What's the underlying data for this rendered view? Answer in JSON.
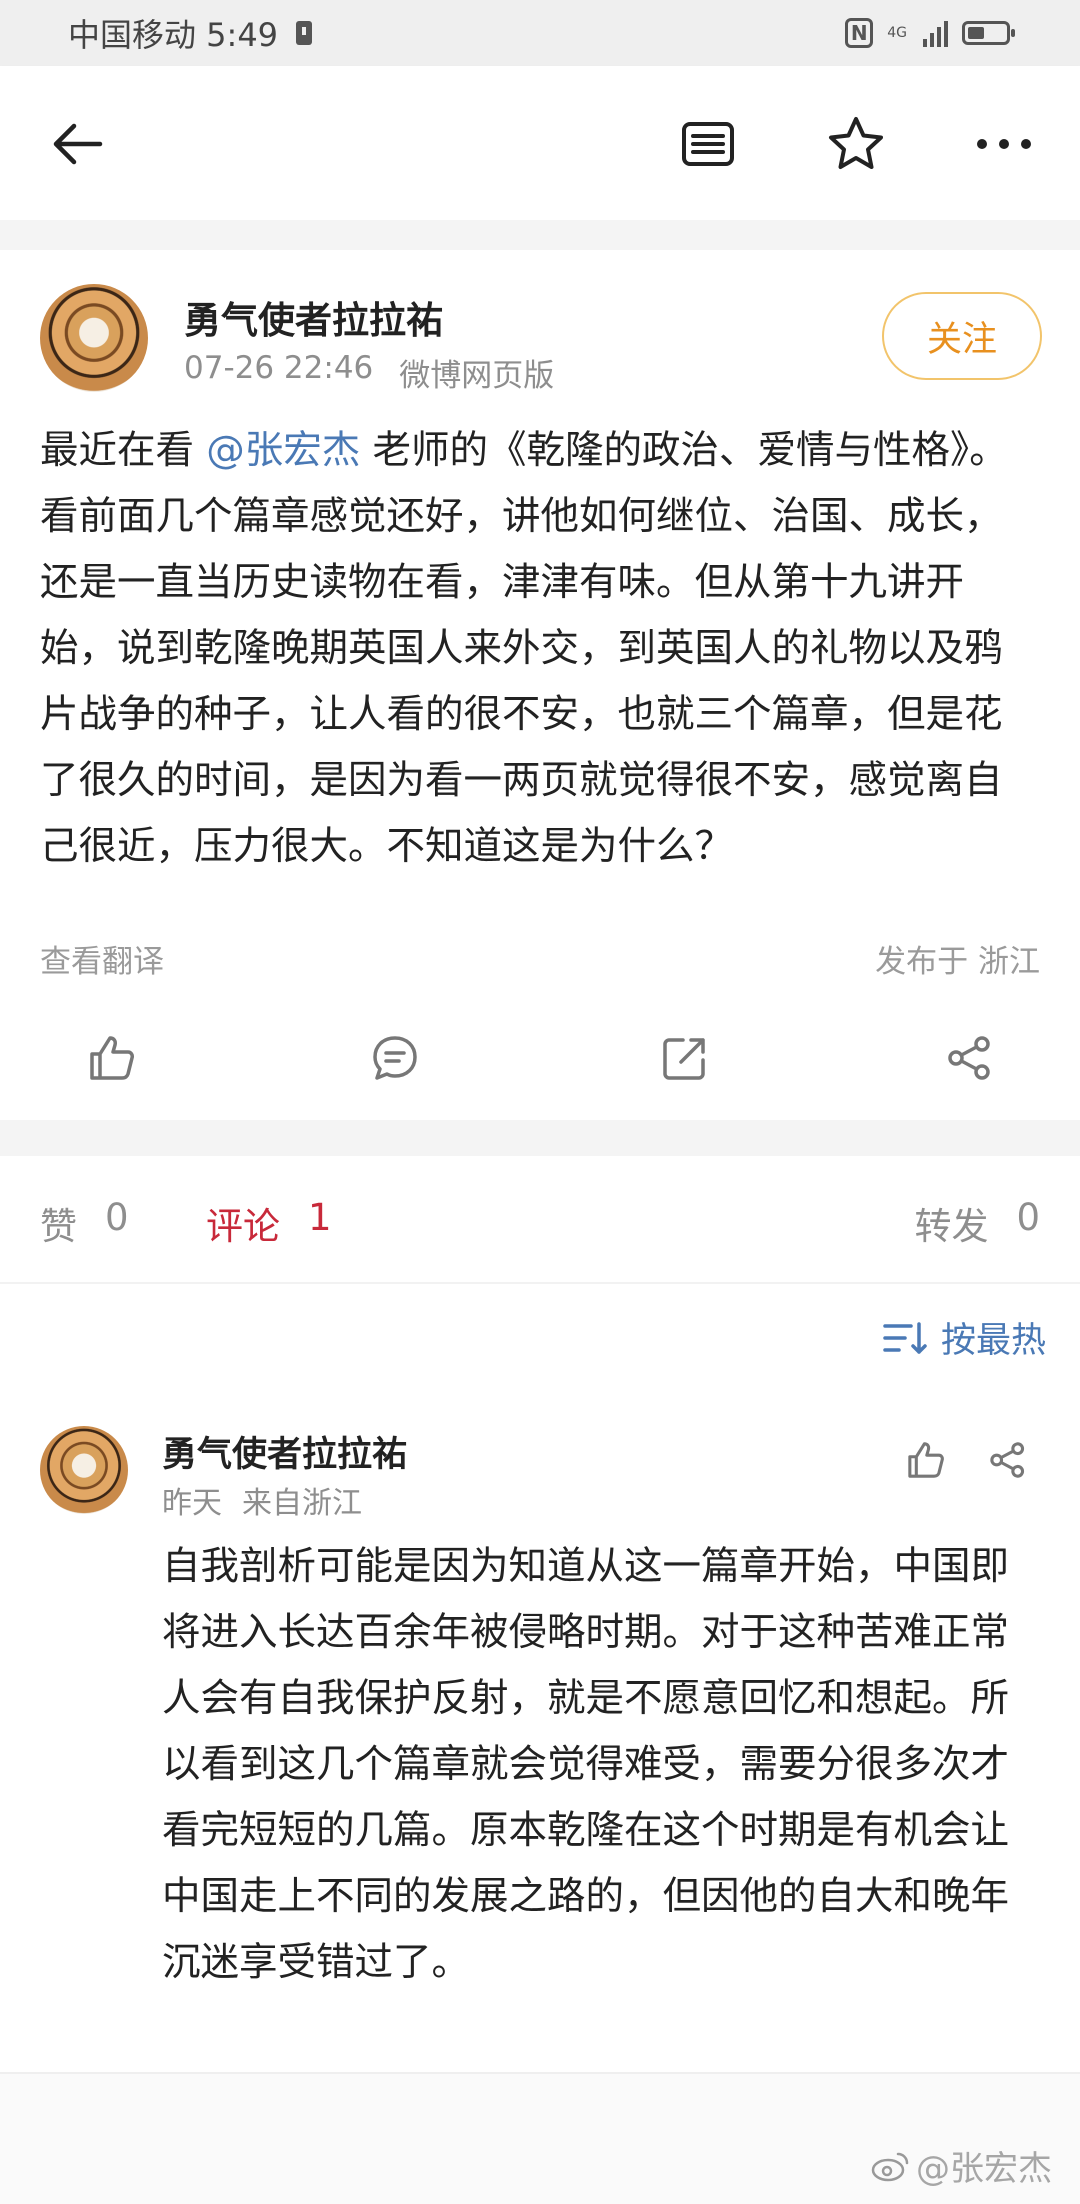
{
  "status_bar": {
    "carrier_time": "中国移动 5:49",
    "network": "4G"
  },
  "toolbar": {
    "back_icon": "arrow-left-icon",
    "comments_icon": "comment-list-icon",
    "favorite_icon": "star-icon",
    "more_icon": "more-dots-icon"
  },
  "post": {
    "author": "勇气使者拉拉祐",
    "date": "07-26 22:46",
    "source": "微博网页版",
    "follow_label": "关注",
    "text_before": "最近在看 ",
    "mention": "@张宏杰",
    "text_after": " 老师的《乾隆的政治、爱情与性格》。看前面几个篇章感觉还好，讲他如何继位、治国、成长，还是一直当历史读物在看，津津有味。但从第十九讲开始，说到乾隆晚期英国人来外交，到英国人的礼物以及鸦片战争的种子，让人看的很不安，也就三个篇章，但是花了很久的时间，是因为看一两页就觉得很不安，感觉离自己很近，压力很大。不知道这是为什么？",
    "translate_label": "查看翻译",
    "location": "发布于 浙江"
  },
  "tabs": {
    "likes_label": "赞",
    "likes_count": "0",
    "comments_label": "评论",
    "comments_count": "1",
    "reposts_label": "转发",
    "reposts_count": "0"
  },
  "sort": {
    "label": "按最热"
  },
  "comment": {
    "author": "勇气使者拉拉祐",
    "time": "昨天",
    "location": "来自浙江",
    "text": "自我剖析可能是因为知道从这一篇章开始，中国即将进入长达百余年被侵略时期。对于这种苦难正常人会有自我保护反射，就是不愿意回忆和想起。所以看到这几个篇章就会觉得难受，需要分很多次才看完短短的几篇。原本乾隆在这个时期是有机会让中国走上不同的发展之路的，但因他的自大和晚年沉迷享受错过了。"
  },
  "watermark": "@张宏杰",
  "colors": {
    "accent_orange": "#e8901f",
    "follow_border": "#f2c46b",
    "link_blue": "#4a79b5",
    "active_tab_red": "#c8293a",
    "muted_gray": "#8e8e8e"
  }
}
